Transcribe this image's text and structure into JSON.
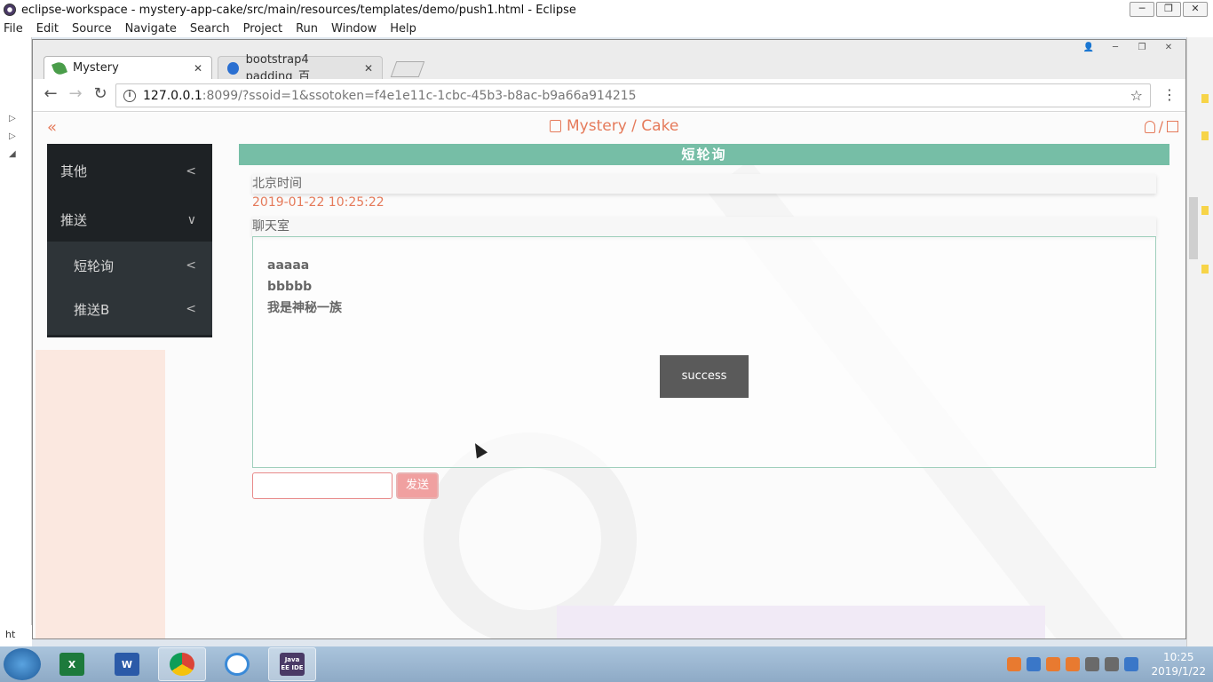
{
  "eclipse": {
    "title": "eclipse-workspace - mystery-app-cake/src/main/resources/templates/demo/push1.html - Eclipse",
    "window_buttons": [
      "─",
      "❐",
      "✕"
    ],
    "menu": [
      "File",
      "Edit",
      "Source",
      "Navigate",
      "Search",
      "Project",
      "Run",
      "Window",
      "Help"
    ],
    "status_text": "ht"
  },
  "browser": {
    "tabs": [
      {
        "label": "Mystery",
        "close": "✕"
      },
      {
        "label": "bootstrap4 padding_百",
        "close": "✕"
      }
    ],
    "window_buttons": [
      "👤",
      "─",
      "❐",
      "✕"
    ],
    "url_host": "127.0.0.1",
    "url_path": ":8099/?ssoid=1&ssotoken=f4e1e11c-1cbc-45b3-b8ac-b9a66a914215",
    "back": "←",
    "forward": "→",
    "reload": "↻",
    "star": "☆",
    "menu": "⋮"
  },
  "page": {
    "collapse": "«",
    "brand": "Mystery / Cake",
    "user_sep": "/",
    "sidebar": {
      "items": [
        {
          "label": "其他",
          "chevron": "<"
        },
        {
          "label": "推送",
          "chevron": "∨"
        }
      ],
      "sub_items": [
        {
          "label": "短轮询",
          "chevron": "<"
        },
        {
          "label": "推送B",
          "chevron": "<"
        }
      ]
    },
    "banner": "短轮询",
    "time_label": "北京时间",
    "time_value": "2019-01-22 10:25:22",
    "chat_label": "聊天室",
    "messages": [
      "aaaaa",
      "bbbbb",
      "我是神秘一族"
    ],
    "toast": "success",
    "input_value": "",
    "send_button": "发送"
  },
  "taskbar": {
    "apps": [
      "X",
      "W",
      "",
      "",
      "Java EE IDE"
    ],
    "clock_time": "10:25",
    "clock_date": "2019/1/22"
  }
}
